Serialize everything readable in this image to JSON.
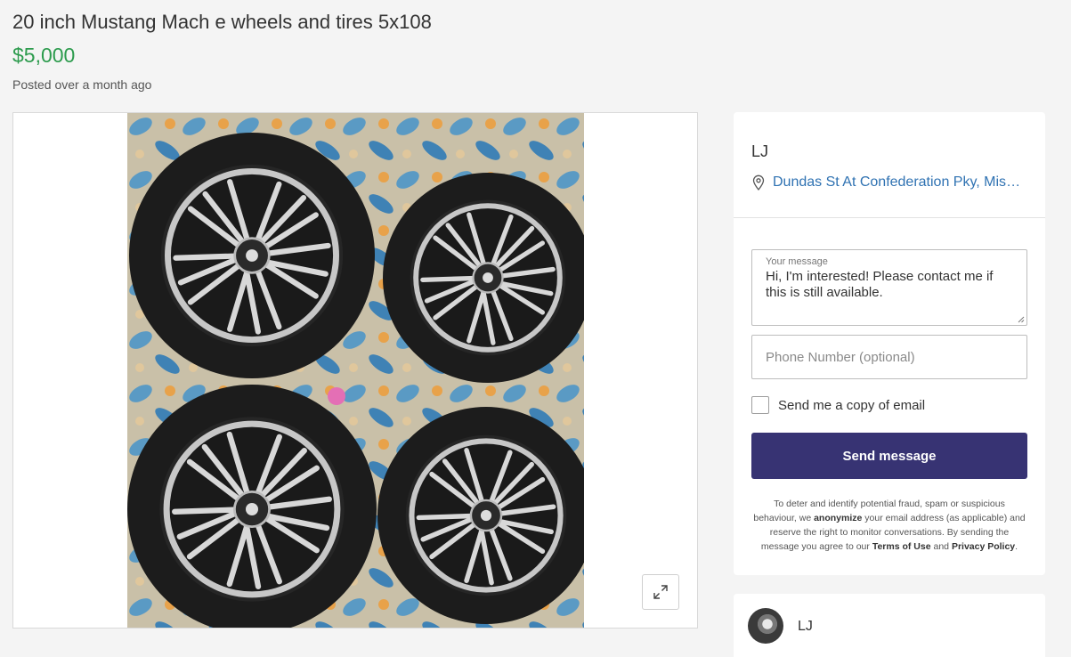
{
  "listing": {
    "title": "20 inch Mustang Mach e wheels and tires 5x108",
    "price": "$5,000",
    "posted": "Posted over a month ago"
  },
  "gallery": {
    "expand_icon": "expand-icon"
  },
  "seller": {
    "name": "LJ",
    "location_icon": "map-pin-icon",
    "location": "Dundas St At Confederation Pky, Missi..."
  },
  "contact_form": {
    "message_label": "Your message",
    "message_value": "Hi, I'm interested! Please contact me if this is still available.",
    "phone_placeholder": "Phone Number (optional)",
    "copy_label": "Send me a copy of email",
    "send_label": "Send message",
    "disclaimer": {
      "part1": "To deter and identify potential fraud, spam or suspicious behaviour, we ",
      "bold1": "anonymize",
      "part2": " your email address (as applicable) and reserve the right to monitor conversations. By sending the message you agree to our ",
      "bold2": "Terms of Use",
      "part3": " and ",
      "bold3": "Privacy Policy",
      "part4": "."
    }
  },
  "profile": {
    "name": "LJ"
  },
  "colors": {
    "price": "#2c9b4d",
    "link": "#2f72b2",
    "button": "#373373"
  }
}
